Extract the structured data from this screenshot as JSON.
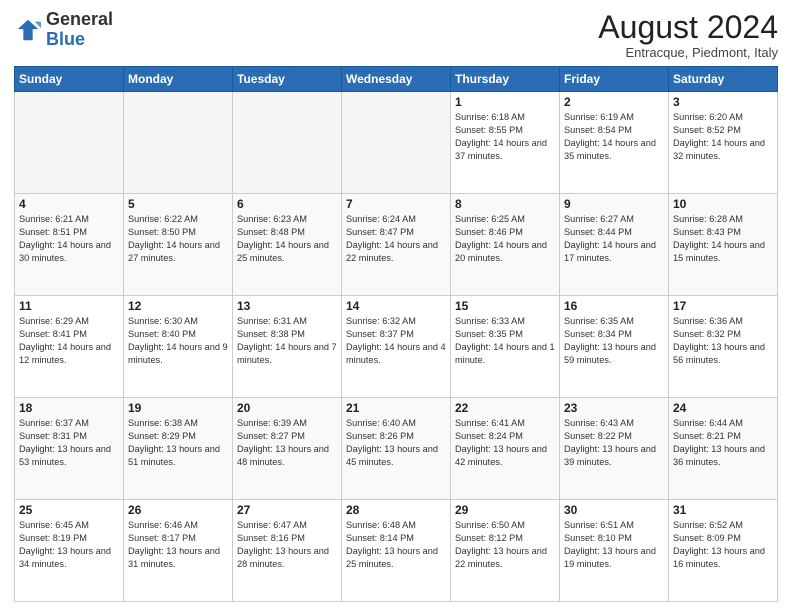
{
  "header": {
    "logo_general": "General",
    "logo_blue": "Blue",
    "month_year": "August 2024",
    "location": "Entracque, Piedmont, Italy"
  },
  "weekdays": [
    "Sunday",
    "Monday",
    "Tuesday",
    "Wednesday",
    "Thursday",
    "Friday",
    "Saturday"
  ],
  "weeks": [
    [
      {
        "day": "",
        "info": ""
      },
      {
        "day": "",
        "info": ""
      },
      {
        "day": "",
        "info": ""
      },
      {
        "day": "",
        "info": ""
      },
      {
        "day": "1",
        "info": "Sunrise: 6:18 AM\nSunset: 8:55 PM\nDaylight: 14 hours and 37 minutes."
      },
      {
        "day": "2",
        "info": "Sunrise: 6:19 AM\nSunset: 8:54 PM\nDaylight: 14 hours and 35 minutes."
      },
      {
        "day": "3",
        "info": "Sunrise: 6:20 AM\nSunset: 8:52 PM\nDaylight: 14 hours and 32 minutes."
      }
    ],
    [
      {
        "day": "4",
        "info": "Sunrise: 6:21 AM\nSunset: 8:51 PM\nDaylight: 14 hours and 30 minutes."
      },
      {
        "day": "5",
        "info": "Sunrise: 6:22 AM\nSunset: 8:50 PM\nDaylight: 14 hours and 27 minutes."
      },
      {
        "day": "6",
        "info": "Sunrise: 6:23 AM\nSunset: 8:48 PM\nDaylight: 14 hours and 25 minutes."
      },
      {
        "day": "7",
        "info": "Sunrise: 6:24 AM\nSunset: 8:47 PM\nDaylight: 14 hours and 22 minutes."
      },
      {
        "day": "8",
        "info": "Sunrise: 6:25 AM\nSunset: 8:46 PM\nDaylight: 14 hours and 20 minutes."
      },
      {
        "day": "9",
        "info": "Sunrise: 6:27 AM\nSunset: 8:44 PM\nDaylight: 14 hours and 17 minutes."
      },
      {
        "day": "10",
        "info": "Sunrise: 6:28 AM\nSunset: 8:43 PM\nDaylight: 14 hours and 15 minutes."
      }
    ],
    [
      {
        "day": "11",
        "info": "Sunrise: 6:29 AM\nSunset: 8:41 PM\nDaylight: 14 hours and 12 minutes."
      },
      {
        "day": "12",
        "info": "Sunrise: 6:30 AM\nSunset: 8:40 PM\nDaylight: 14 hours and 9 minutes."
      },
      {
        "day": "13",
        "info": "Sunrise: 6:31 AM\nSunset: 8:38 PM\nDaylight: 14 hours and 7 minutes."
      },
      {
        "day": "14",
        "info": "Sunrise: 6:32 AM\nSunset: 8:37 PM\nDaylight: 14 hours and 4 minutes."
      },
      {
        "day": "15",
        "info": "Sunrise: 6:33 AM\nSunset: 8:35 PM\nDaylight: 14 hours and 1 minute."
      },
      {
        "day": "16",
        "info": "Sunrise: 6:35 AM\nSunset: 8:34 PM\nDaylight: 13 hours and 59 minutes."
      },
      {
        "day": "17",
        "info": "Sunrise: 6:36 AM\nSunset: 8:32 PM\nDaylight: 13 hours and 56 minutes."
      }
    ],
    [
      {
        "day": "18",
        "info": "Sunrise: 6:37 AM\nSunset: 8:31 PM\nDaylight: 13 hours and 53 minutes."
      },
      {
        "day": "19",
        "info": "Sunrise: 6:38 AM\nSunset: 8:29 PM\nDaylight: 13 hours and 51 minutes."
      },
      {
        "day": "20",
        "info": "Sunrise: 6:39 AM\nSunset: 8:27 PM\nDaylight: 13 hours and 48 minutes."
      },
      {
        "day": "21",
        "info": "Sunrise: 6:40 AM\nSunset: 8:26 PM\nDaylight: 13 hours and 45 minutes."
      },
      {
        "day": "22",
        "info": "Sunrise: 6:41 AM\nSunset: 8:24 PM\nDaylight: 13 hours and 42 minutes."
      },
      {
        "day": "23",
        "info": "Sunrise: 6:43 AM\nSunset: 8:22 PM\nDaylight: 13 hours and 39 minutes."
      },
      {
        "day": "24",
        "info": "Sunrise: 6:44 AM\nSunset: 8:21 PM\nDaylight: 13 hours and 36 minutes."
      }
    ],
    [
      {
        "day": "25",
        "info": "Sunrise: 6:45 AM\nSunset: 8:19 PM\nDaylight: 13 hours and 34 minutes."
      },
      {
        "day": "26",
        "info": "Sunrise: 6:46 AM\nSunset: 8:17 PM\nDaylight: 13 hours and 31 minutes."
      },
      {
        "day": "27",
        "info": "Sunrise: 6:47 AM\nSunset: 8:16 PM\nDaylight: 13 hours and 28 minutes."
      },
      {
        "day": "28",
        "info": "Sunrise: 6:48 AM\nSunset: 8:14 PM\nDaylight: 13 hours and 25 minutes."
      },
      {
        "day": "29",
        "info": "Sunrise: 6:50 AM\nSunset: 8:12 PM\nDaylight: 13 hours and 22 minutes."
      },
      {
        "day": "30",
        "info": "Sunrise: 6:51 AM\nSunset: 8:10 PM\nDaylight: 13 hours and 19 minutes."
      },
      {
        "day": "31",
        "info": "Sunrise: 6:52 AM\nSunset: 8:09 PM\nDaylight: 13 hours and 16 minutes."
      }
    ]
  ]
}
